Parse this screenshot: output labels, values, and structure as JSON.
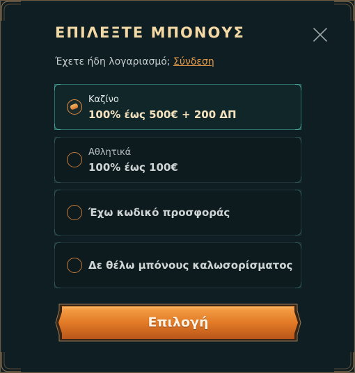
{
  "modal": {
    "title": "ΕΠΙΛΕΞΤΕ ΜΠΟΝΟΥΣ",
    "close_icon": "close-icon",
    "account_prompt": "Έχετε ήδη λογαριασμό;",
    "login_link": "Σύνδεση"
  },
  "options": [
    {
      "category": "Καζίνο",
      "offer": "100% έως 500€ + 200 ΔΠ",
      "selected": true
    },
    {
      "category": "Αθλητικά",
      "offer": "100% έως 100€",
      "selected": false
    },
    {
      "label": "Έχω κωδικό προσφοράς",
      "selected": false
    },
    {
      "label": "Δε θέλω μπόνους καλωσορίσματος",
      "selected": false
    }
  ],
  "cta": {
    "label": "Επιλογή"
  },
  "colors": {
    "accent_orange": "#e07a2a",
    "title_gold": "#f3d9a6",
    "selected_border": "#2c6f69",
    "background": "#0f1e22"
  }
}
